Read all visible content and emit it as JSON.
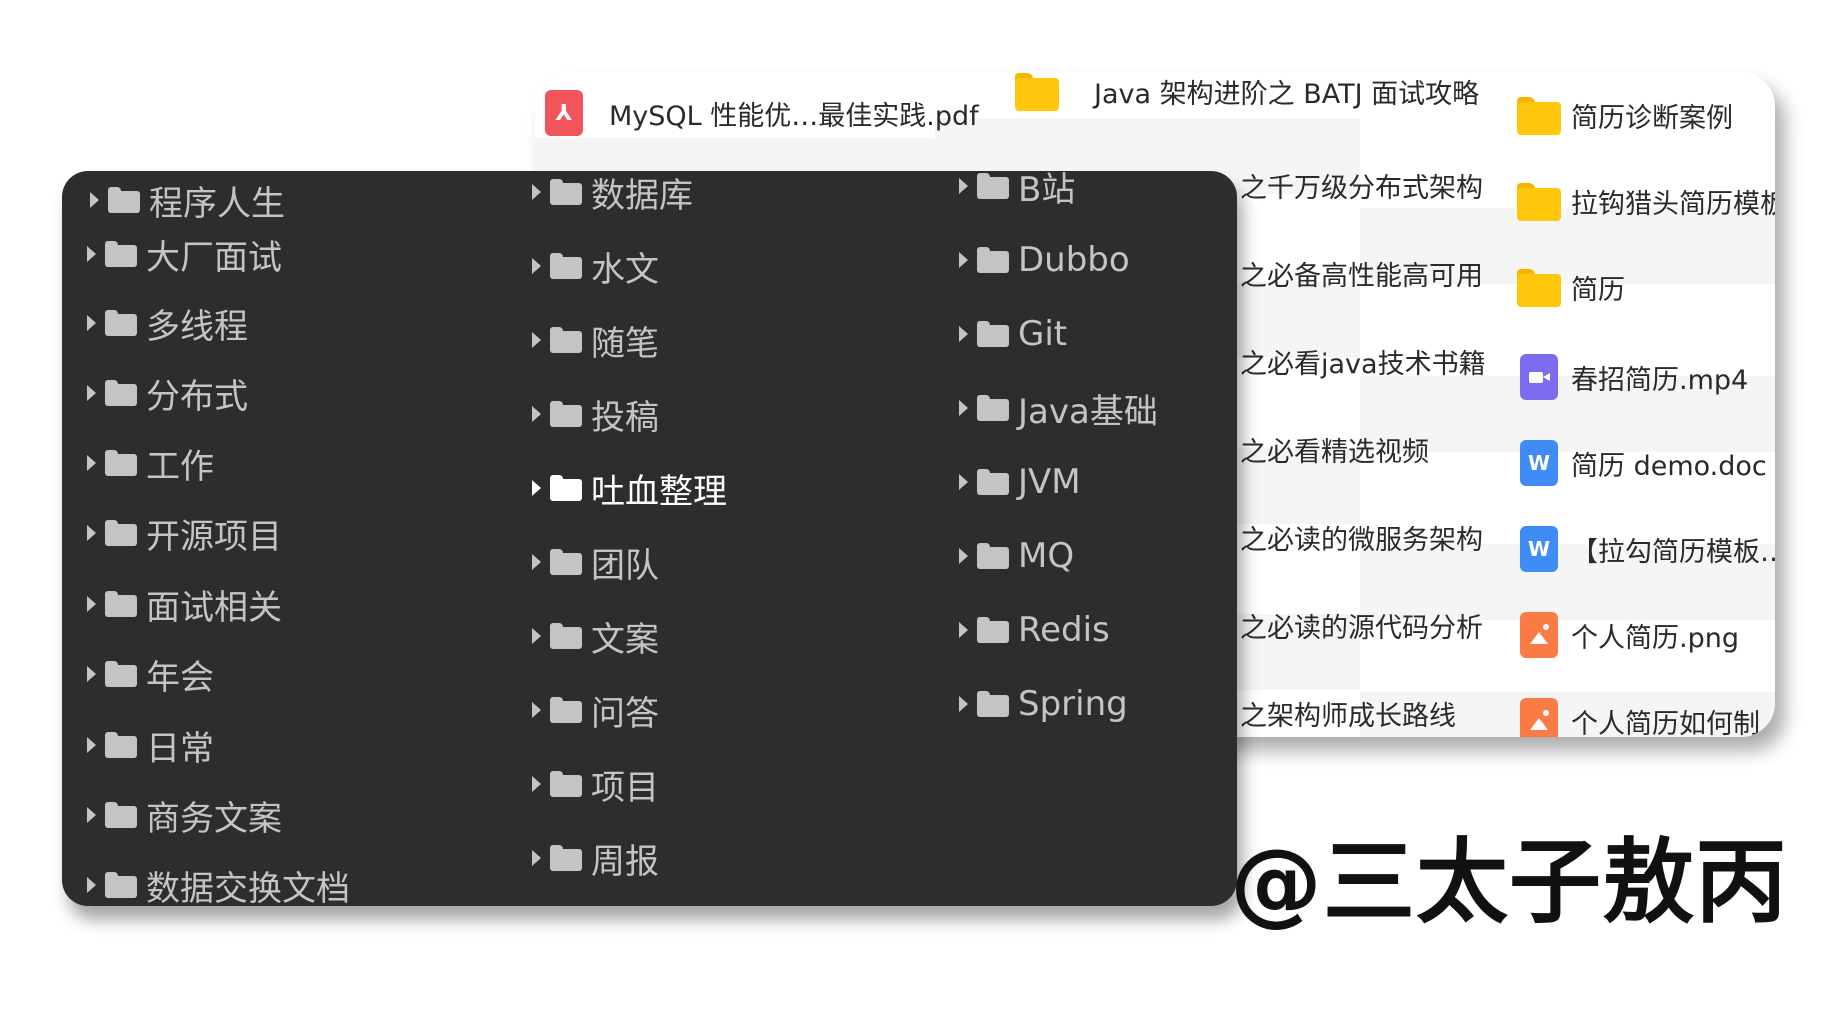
{
  "file_list": {
    "col1": [
      {
        "name": "MySQL 性能优…最佳实践.pdf",
        "icon": "pdf-icon"
      }
    ],
    "col2": [
      {
        "name": "Java 架构进阶之 BATJ 面试攻略",
        "icon": "folder-icon"
      },
      {
        "name": "之千万级分布式架构",
        "icon": "folder-icon"
      },
      {
        "name": "之必备高性能高可用",
        "icon": "folder-icon"
      },
      {
        "name": "之必看java技术书籍",
        "icon": "folder-icon"
      },
      {
        "name": "之必看精选视频",
        "icon": "folder-icon"
      },
      {
        "name": "之必读的微服务架构",
        "icon": "folder-icon"
      },
      {
        "name": "之必读的源代码分析",
        "icon": "folder-icon"
      },
      {
        "name": "之架构师成长路线",
        "icon": "folder-icon"
      }
    ],
    "col3": [
      {
        "name": "简历诊断案例",
        "icon": "folder-icon",
        "letter": ""
      },
      {
        "name": "拉钩猎头简历模板",
        "icon": "folder-icon",
        "letter": ""
      },
      {
        "name": "简历",
        "icon": "folder-icon",
        "letter": ""
      },
      {
        "name": "春招简历.mp4",
        "icon": "video-icon",
        "letter": ""
      },
      {
        "name": "简历 demo.doc",
        "icon": "word-icon",
        "letter": "W"
      },
      {
        "name": "【拉勾简历模板…",
        "icon": "word-icon",
        "letter": "W"
      },
      {
        "name": "个人简历.png",
        "icon": "image-icon",
        "letter": ""
      },
      {
        "name": "个人简历如何制…",
        "icon": "image-icon",
        "letter": ""
      }
    ]
  },
  "tree": {
    "col1": [
      "程序人生",
      "大厂面试",
      "多线程",
      "分布式",
      "工作",
      "开源项目",
      "面试相关",
      "年会",
      "日常",
      "商务文案",
      "数据交换文档"
    ],
    "col2": [
      "数据库",
      "水文",
      "随笔",
      "投稿",
      "吐血整理",
      "团队",
      "文案",
      "问答",
      "项目",
      "周报"
    ],
    "col3": [
      "B站",
      "Dubbo",
      "Git",
      "Java基础",
      "JVM",
      "MQ",
      "Redis",
      "Spring"
    ],
    "selected": "吐血整理"
  },
  "watermark": "@三太子敖丙",
  "colors": {
    "dark_panel": "#2d2d30",
    "tree_text": "#c4c4c6",
    "folder_yellow": "#ffc60b",
    "pdf_red": "#f2545b",
    "word_blue": "#3f8cf6",
    "video_purple": "#7b6cf0",
    "image_orange": "#fb7b45"
  }
}
